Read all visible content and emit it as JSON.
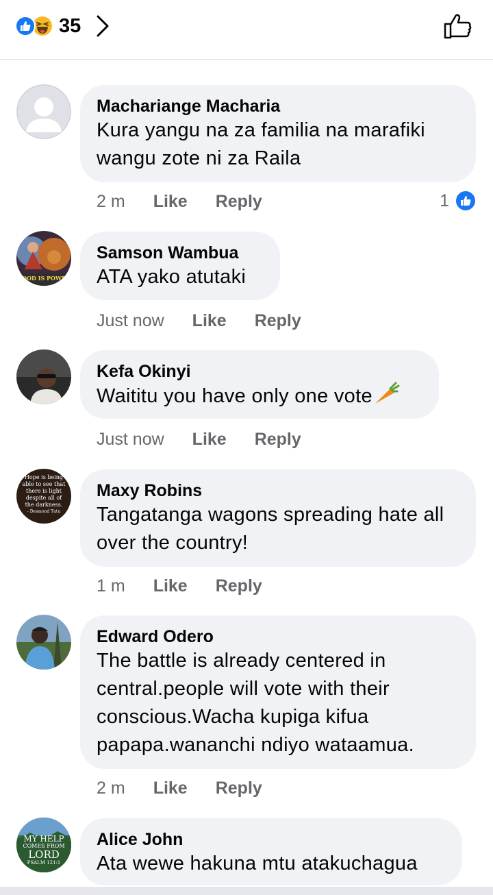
{
  "header": {
    "reaction_count": "35",
    "reactions": [
      "like-icon",
      "haha-icon"
    ]
  },
  "comments": [
    {
      "author": "Machariange Macharia",
      "text": "Kura yangu na za familia na marafiki wangu zote ni za Raila",
      "time": "2 m",
      "like_label": "Like",
      "reply_label": "Reply",
      "likes": "1"
    },
    {
      "author": "Samson Wambua",
      "text": "ATA yako atutaki",
      "time": "Just now",
      "like_label": "Like",
      "reply_label": "Reply"
    },
    {
      "author": "Kefa Okinyi",
      "text": "Waititu you have only one vote",
      "time": "Just now",
      "like_label": "Like",
      "reply_label": "Reply"
    },
    {
      "author": "Maxy Robins",
      "text": "Tangatanga wagons spreading hate all over the country!",
      "time": "1 m",
      "like_label": "Like",
      "reply_label": "Reply"
    },
    {
      "author": "Edward Odero",
      "text": "The battle is already centered in central.people will vote with their conscious.Wacha kupiga kifua papapa.wananchi ndiyo wataamua.",
      "time": "2 m",
      "like_label": "Like",
      "reply_label": "Reply"
    },
    {
      "author": "Alice John",
      "text": "Ata wewe hakuna mtu atakuchagua",
      "time": "",
      "like_label": "",
      "reply_label": ""
    }
  ],
  "avatar_images": {
    "samson": {
      "lines": [
        "GOOD IS POWER"
      ]
    },
    "maxy": {
      "lines": [
        "Hope is being",
        "able to see that",
        "there is light",
        "despite all of",
        "the darkness.",
        "- Desmond Tutu"
      ]
    },
    "alice": {
      "lines": [
        "MY HELP",
        "COMES FROM",
        "LORD",
        "PSALM 121:1"
      ]
    }
  },
  "colors": {
    "bubble": "#f0f2f5",
    "meta_text": "#65676b",
    "like_blue": "#1877f2",
    "haha_yellow": "#f7b928"
  }
}
